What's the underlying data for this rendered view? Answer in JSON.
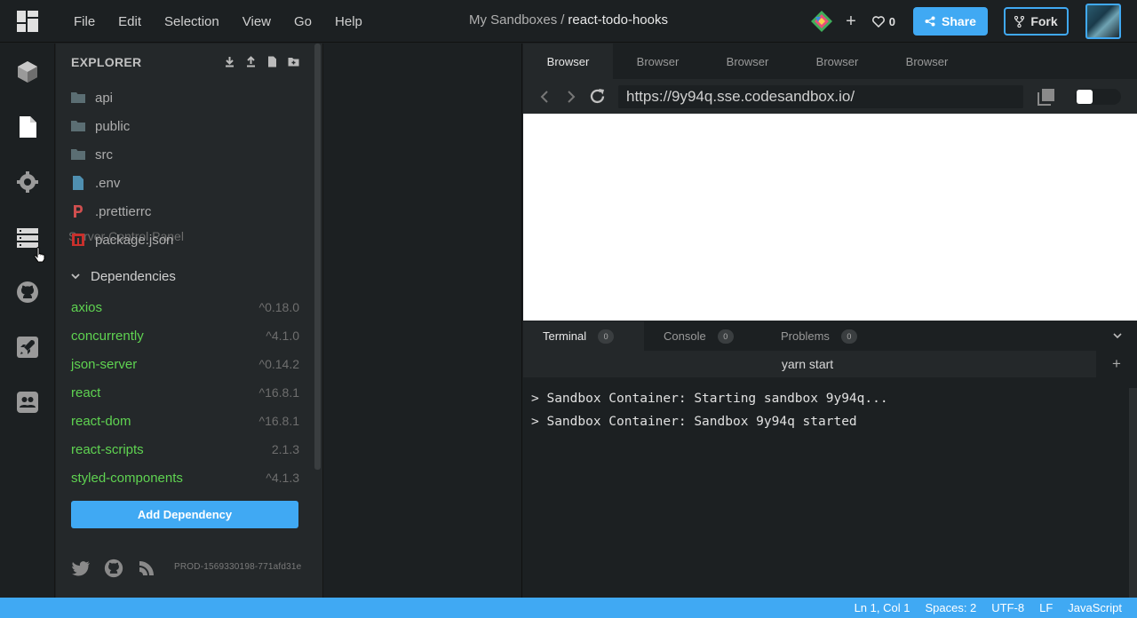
{
  "menu": [
    "File",
    "Edit",
    "Selection",
    "View",
    "Go",
    "Help"
  ],
  "title": {
    "folder": "My Sandboxes",
    "separator": "/",
    "sandbox": "react-todo-hooks"
  },
  "toolbar": {
    "plus": "+",
    "likes": "0",
    "share": "Share",
    "fork": "Fork"
  },
  "explorer": {
    "heading": "EXPLORER",
    "files": [
      {
        "name": "api",
        "icon": "folder-icon"
      },
      {
        "name": "public",
        "icon": "folder-icon"
      },
      {
        "name": "src",
        "icon": "folder-icon"
      },
      {
        "name": ".env",
        "icon": "file-icon"
      },
      {
        "name": ".prettierrc",
        "icon": "prettier-icon"
      },
      {
        "name": "package.json",
        "icon": "npm-icon"
      }
    ],
    "tooltip": "Server Control Panel",
    "dependencies_label": "Dependencies",
    "dependencies": [
      {
        "name": "axios",
        "version": "^0.18.0"
      },
      {
        "name": "concurrently",
        "version": "^4.1.0"
      },
      {
        "name": "json-server",
        "version": "^0.14.2"
      },
      {
        "name": "react",
        "version": "^16.8.1"
      },
      {
        "name": "react-dom",
        "version": "^16.8.1"
      },
      {
        "name": "react-scripts",
        "version": "2.1.3"
      },
      {
        "name": "styled-components",
        "version": "^4.1.3"
      }
    ],
    "add_dependency": "Add Dependency",
    "build": "PROD-1569330198-771afd31e"
  },
  "browser": {
    "tabs": [
      "Browser",
      "Browser",
      "Browser",
      "Browser",
      "Browser"
    ],
    "url": "https://9y94q.sse.codesandbox.io/"
  },
  "terminal": {
    "tabs": [
      {
        "label": "Terminal",
        "count": "0"
      },
      {
        "label": "Console",
        "count": "0"
      },
      {
        "label": "Problems",
        "count": "0"
      }
    ],
    "command": "yarn start",
    "add": "+",
    "lines": [
      "> Sandbox Container: Starting sandbox 9y94q...",
      "> Sandbox Container: Sandbox 9y94q started"
    ]
  },
  "status": {
    "position": "Ln 1, Col 1",
    "spaces": "Spaces: 2",
    "encoding": "UTF-8",
    "eol": "LF",
    "language": "JavaScript"
  },
  "colors": {
    "accent": "#40a9f3",
    "dependency": "#5fd351"
  }
}
